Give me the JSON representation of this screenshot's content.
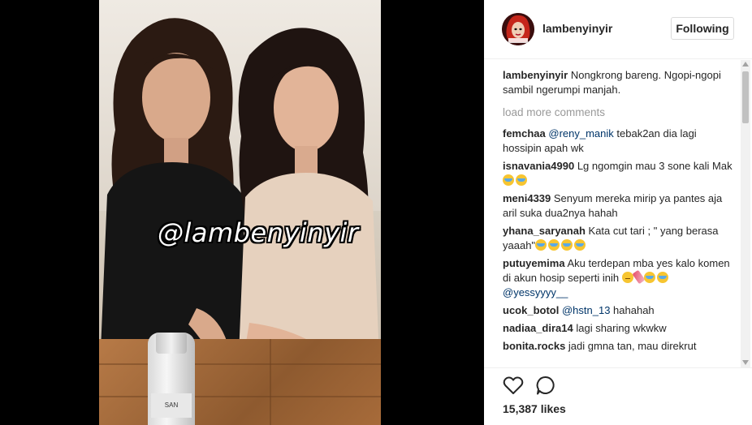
{
  "post": {
    "watermark": "@lambenyinyir",
    "bottle_brand": "SAN"
  },
  "header": {
    "username": "lambenyinyir",
    "follow_button": "Following"
  },
  "caption": {
    "username": "lambenyinyir",
    "text": "Nongkrong bareng. Ngopi-ngopi sambil ngerumpi manjah."
  },
  "load_more": "load more comments",
  "comments": [
    {
      "username": "femchaa",
      "mention": "@reny_manik",
      "text": " tebak2an dia lagi hossipin apah wk",
      "emojis": []
    },
    {
      "username": "isnavania4990",
      "mention": "",
      "text": " Lg ngomgin mau 3 sone kali Mak ",
      "emojis": [
        "tear",
        "tear"
      ]
    },
    {
      "username": "meni4339",
      "mention": "",
      "text": " Senyum mereka mirip ya pantes aja aril suka dua2nya hahah",
      "emojis": []
    },
    {
      "username": "yhana_saryanah",
      "mention": "",
      "text": " Kata cut tari ; \" yang berasa yaaah\"",
      "emojis": [
        "tear",
        "tear",
        "tear",
        "tear"
      ]
    },
    {
      "username": "putuyemima",
      "mention": "",
      "text": " Aku terdepan mba yes kalo komen di akun hosip seperti inih ",
      "emojis": [
        "meh",
        "nail",
        "tear",
        "tear"
      ],
      "trailing_mention": "@yessyyyy__"
    },
    {
      "username": "ucok_botol",
      "mention": "@hstn_13",
      "text": " hahahah",
      "emojis": []
    },
    {
      "username": "nadiaa_dira14",
      "mention": "",
      "text": " lagi sharing wkwkw",
      "emojis": []
    },
    {
      "username": "bonita.rocks",
      "mention": "",
      "text": " jadi gmna tan, mau direkrut",
      "emojis": []
    }
  ],
  "actions": {
    "like_icon": "heart-outline-icon",
    "comment_icon": "speech-bubble-icon"
  },
  "likes": "15,387 likes",
  "colors": {
    "text": "#262626",
    "mention": "#003569",
    "muted": "#999999",
    "border": "#dbdbdb"
  }
}
